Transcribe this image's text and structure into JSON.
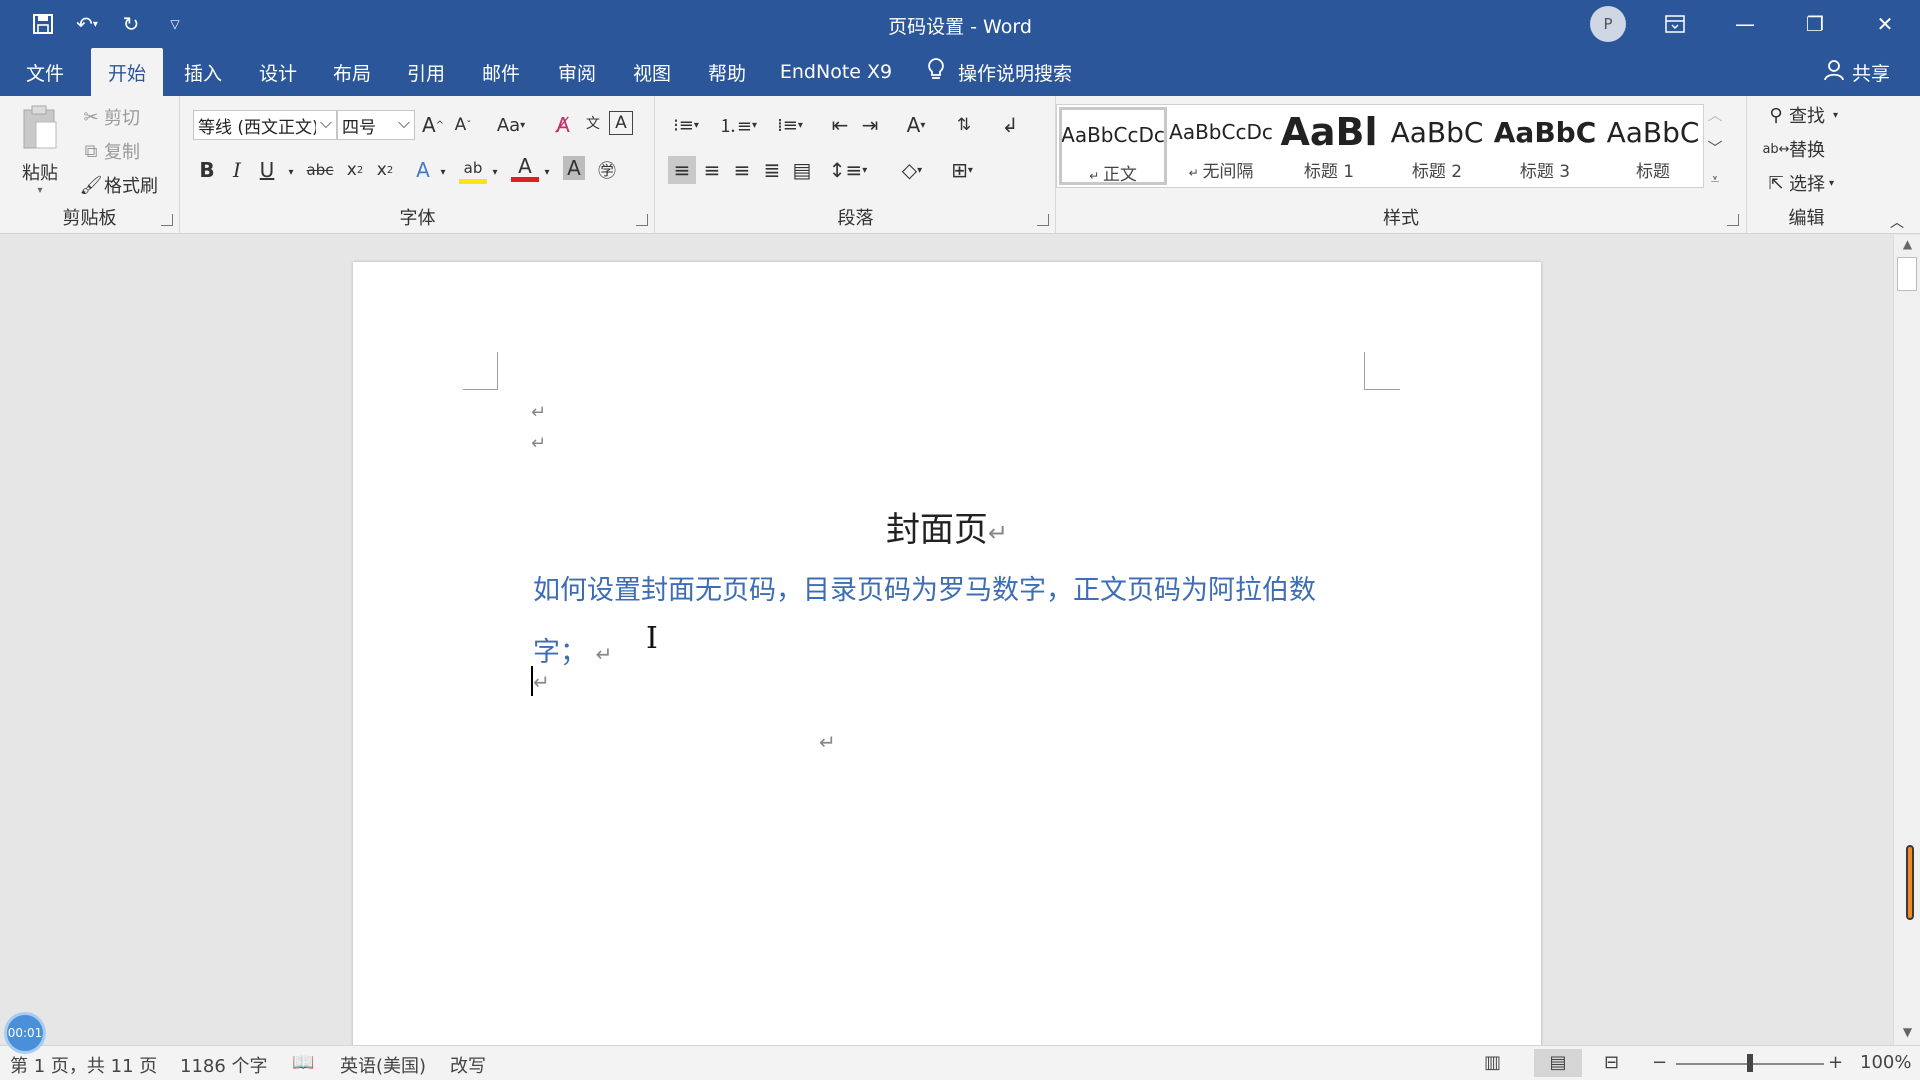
{
  "window": {
    "title": "页码设置  -  Word",
    "avatar_letter": "P"
  },
  "qat": {
    "save_icon": "save-icon",
    "undo_icon": "undo-icon",
    "redo_icon": "redo-icon",
    "customize_icon": "customize-icon"
  },
  "tabs": [
    {
      "label": "文件"
    },
    {
      "label": "开始"
    },
    {
      "label": "插入"
    },
    {
      "label": "设计"
    },
    {
      "label": "布局"
    },
    {
      "label": "引用"
    },
    {
      "label": "邮件"
    },
    {
      "label": "审阅"
    },
    {
      "label": "视图"
    },
    {
      "label": "帮助"
    },
    {
      "label": "EndNote X9"
    }
  ],
  "active_tab": "开始",
  "search": {
    "label": "操作说明搜索"
  },
  "share": {
    "label": "共享"
  },
  "clipboard": {
    "paste": "粘贴",
    "cut": "剪切",
    "copy": "复制",
    "format_painter": "格式刷",
    "group_label": "剪贴板"
  },
  "font": {
    "font_name": "等线 (西文正文)",
    "font_size": "四号",
    "group_label": "字体"
  },
  "paragraph": {
    "group_label": "段落"
  },
  "styles": {
    "group_label": "样式",
    "items": [
      {
        "sample": "AaBbCcDc",
        "name": "正文"
      },
      {
        "sample": "AaBbCcDc",
        "name": "无间隔"
      },
      {
        "sample": "AaBl",
        "name": "标题 1"
      },
      {
        "sample": "AaBbC",
        "name": "标题 2"
      },
      {
        "sample": "AaBbC",
        "name": "标题 3"
      },
      {
        "sample": "AaBbC",
        "name": "标题"
      }
    ]
  },
  "editing": {
    "find": "查找",
    "replace": "替换",
    "select": "选择",
    "group_label": "编辑"
  },
  "document": {
    "title": "封面页",
    "body_line1": "如何设置封面无页码，目录页码为罗马数字，正文页码为阿拉伯数",
    "body_line2": "字；",
    "para_mark": "↵"
  },
  "status": {
    "page": "第 1 页，共 11 页",
    "words": "1186 个字",
    "language": "英语(美国)",
    "mode": "改写",
    "zoom": "100%",
    "zoom_fraction": 0.5,
    "timer": "00:01"
  },
  "colors": {
    "ribbon_blue": "#2b579a",
    "body_text_blue": "#3d6db5"
  }
}
